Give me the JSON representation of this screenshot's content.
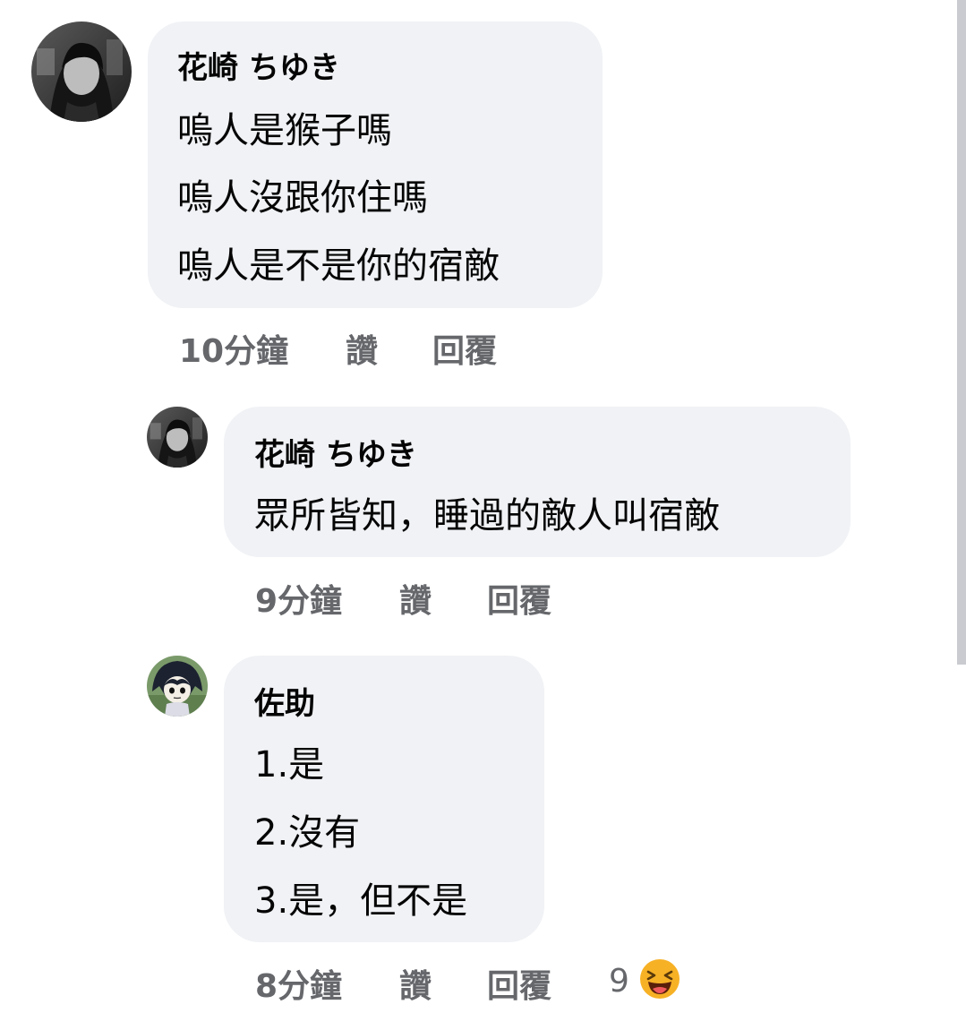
{
  "comments": [
    {
      "author": "花崎 ちゆき",
      "lines": [
        "嗚人是猴子嗎",
        "嗚人沒跟你住嗎",
        "嗚人是不是你的宿敵"
      ],
      "time": "10分鐘",
      "like_label": "讚",
      "reply_label": "回覆"
    },
    {
      "author": "花崎 ちゆき",
      "lines": [
        "眾所皆知，睡過的敵人叫宿敵"
      ],
      "time": "9分鐘",
      "like_label": "讚",
      "reply_label": "回覆"
    },
    {
      "author": "佐助",
      "lines": [
        "1.是",
        "2.沒有",
        "3.是，但不是"
      ],
      "time": "8分鐘",
      "like_label": "讚",
      "reply_label": "回覆",
      "reaction_count": "9",
      "reaction_icon": "laughing-emoji-icon"
    }
  ],
  "colors": {
    "bubble": "#f0f2f5",
    "meta_text": "#65676b",
    "text": "#050505",
    "emoji": "#f7b125"
  }
}
